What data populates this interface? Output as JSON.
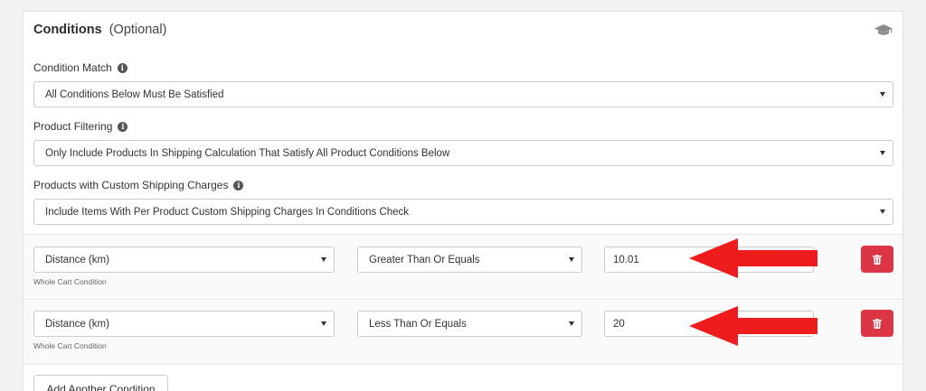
{
  "header": {
    "title": "Conditions",
    "subtitle": "(Optional)",
    "help_icon": "graduation-cap-icon"
  },
  "condition_match": {
    "label": "Condition Match",
    "value": "All Conditions Below Must Be Satisfied"
  },
  "product_filtering": {
    "label": "Product Filtering",
    "value": "Only Include Products In Shipping Calculation That Satisfy All Product Conditions Below"
  },
  "custom_charges": {
    "label": "Products with Custom Shipping Charges",
    "value": "Include Items With Per Product Custom Shipping Charges In Conditions Check"
  },
  "conditions": [
    {
      "type": "Distance (km)",
      "type_hint": "Whole Cart Condition",
      "operator": "Greater Than Or Equals",
      "value": "10.01"
    },
    {
      "type": "Distance (km)",
      "type_hint": "Whole Cart Condition",
      "operator": "Less Than Or Equals",
      "value": "20"
    }
  ],
  "add_button_label": "Add Another Condition",
  "colors": {
    "delete_button": "#dc3545",
    "annotation_arrow": "#ee1c1c"
  }
}
